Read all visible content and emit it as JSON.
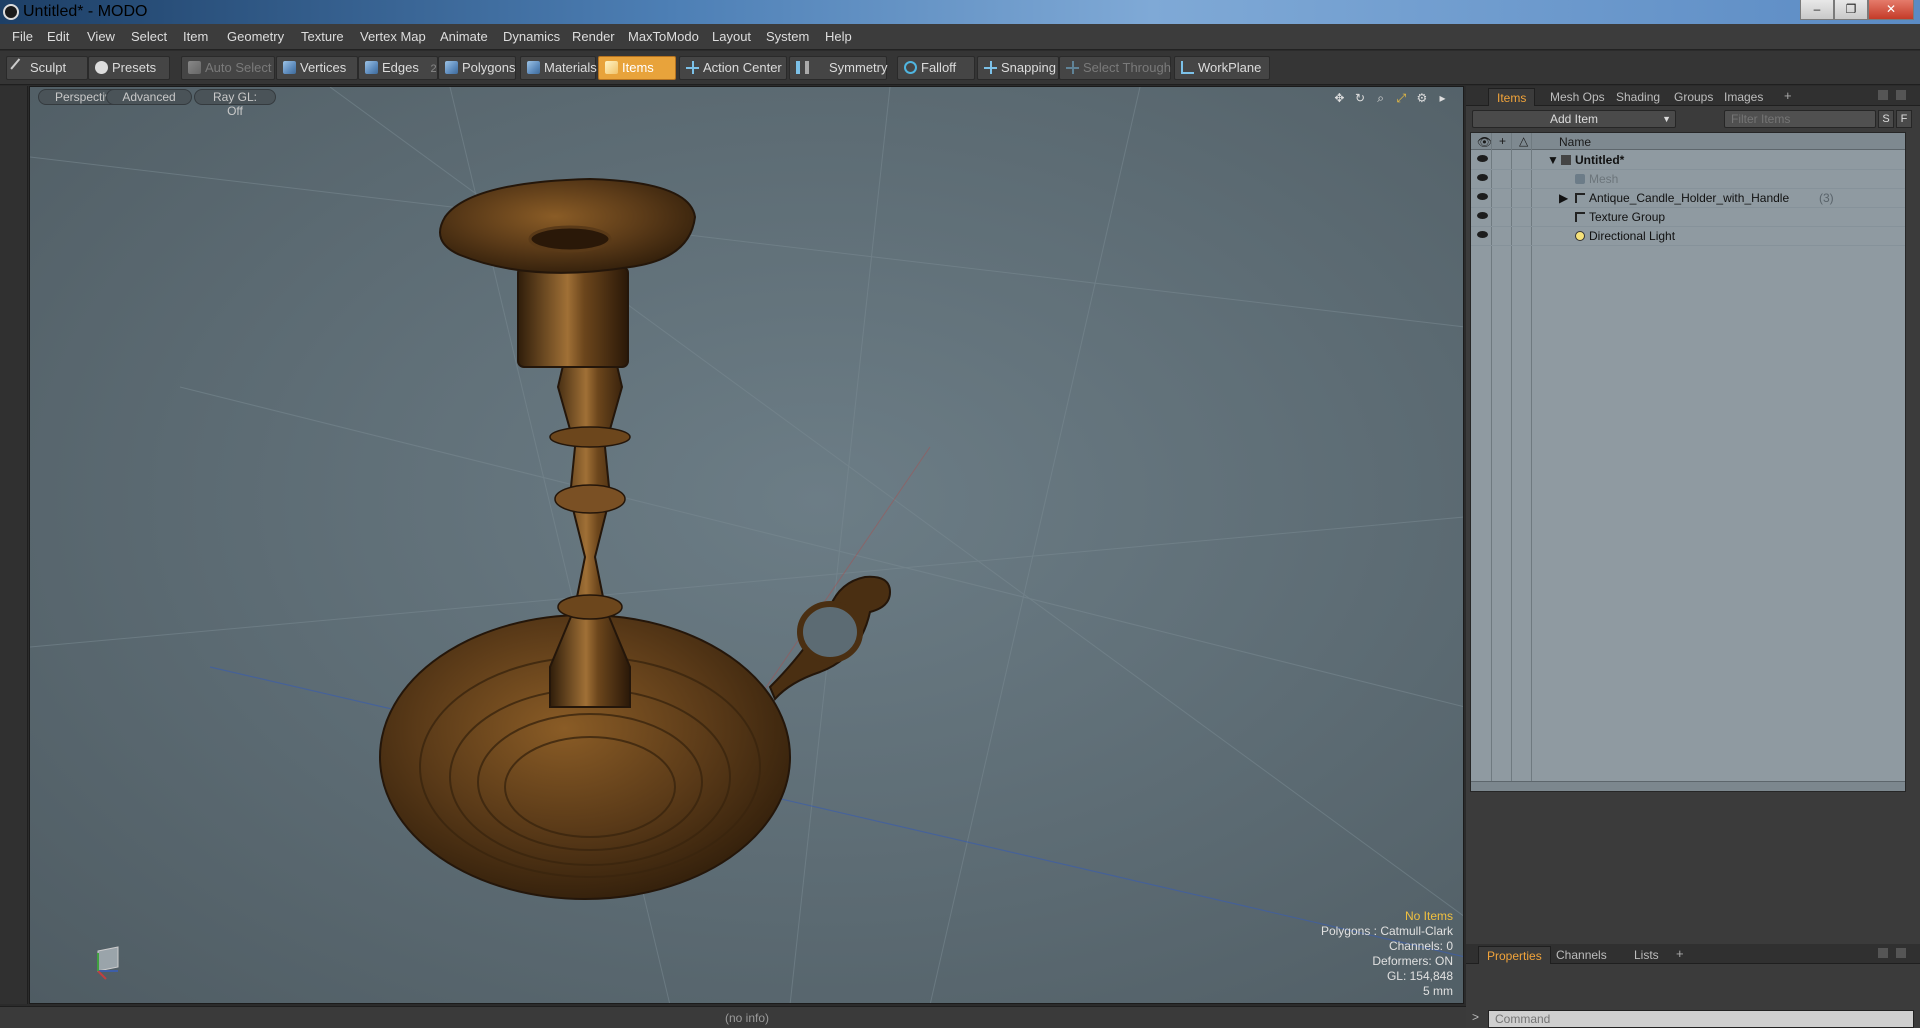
{
  "window": {
    "title": "Untitled* - MODO",
    "controls": [
      "–",
      "❐",
      "✕"
    ]
  },
  "menu": [
    "File",
    "Edit",
    "View",
    "Select",
    "Item",
    "Geometry",
    "Texture",
    "Vertex Map",
    "Animate",
    "Dynamics",
    "Render",
    "MaxToModo",
    "Layout",
    "System",
    "Help"
  ],
  "toolbar": {
    "sculpt": "Sculpt",
    "presets": "Presets",
    "auto_select": "Auto Select",
    "vertices": "Vertices",
    "edges": "Edges",
    "edges_count": "2",
    "polygons": "Polygons",
    "materials": "Materials",
    "items": "Items",
    "action_center": "Action Center",
    "symmetry": "Symmetry",
    "falloff": "Falloff",
    "snapping": "Snapping",
    "select_through": "Select Through",
    "workplane": "WorkPlane"
  },
  "viewport": {
    "view_mode": "Perspective",
    "shading": "Advanced",
    "raygl": "Ray GL: Off",
    "stats": {
      "items": "No Items",
      "polygons": "Polygons : Catmull-Clark",
      "channels": "Channels: 0",
      "deformers": "Deformers: ON",
      "gl": "GL: 154,848",
      "unit": "5 mm"
    }
  },
  "statusbar": {
    "info": "(no info)"
  },
  "items_panel": {
    "tabs": [
      "Items",
      "Mesh Ops",
      "Shading",
      "Groups",
      "Images"
    ],
    "add_item": "Add Item",
    "filter_placeholder": "Filter Items",
    "btn_s": "S",
    "btn_f": "F",
    "column_name": "Name",
    "tree": [
      {
        "label": "Untitled*",
        "bold": true
      },
      {
        "label": "Mesh",
        "dim": true
      },
      {
        "label": "Antique_Candle_Holder_with_Handle",
        "count": "(3)"
      },
      {
        "label": "Texture Group"
      },
      {
        "label": "Directional Light"
      }
    ]
  },
  "properties_panel": {
    "tabs": [
      "Properties",
      "Channels",
      "Lists"
    ],
    "command_prompt": ">",
    "command_placeholder": "Command"
  },
  "colors": {
    "accent": "#e8a33b",
    "active_tab": "#f2a43a",
    "viewport_bg": "#5c6b73",
    "brass": "#5a3a18"
  }
}
